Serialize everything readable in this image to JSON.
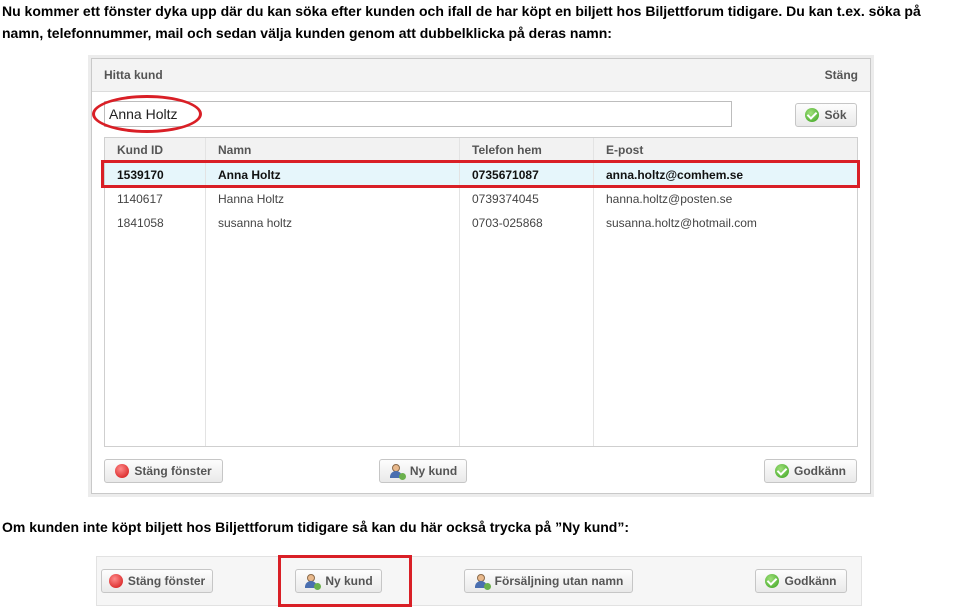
{
  "intro_text": "Nu kommer ett fönster dyka upp där du kan söka efter kunden och ifall de har köpt en biljett hos Biljettforum tidigare. Du kan t.ex. söka på namn, telefonnummer, mail och sedan välja kunden genom att dubbelklicka på deras namn:",
  "dialog": {
    "title": "Hitta kund",
    "close_label": "Stäng",
    "search_value": "Anna Holtz",
    "search_button": "Sök",
    "columns": [
      "Kund ID",
      "Namn",
      "Telefon hem",
      "E-post"
    ],
    "rows": [
      {
        "id": "1539170",
        "name": "Anna Holtz",
        "phone": "0735671087",
        "email": "anna.holtz@comhem.se"
      },
      {
        "id": "1140617",
        "name": "Hanna Holtz",
        "phone": "0739374045",
        "email": "hanna.holtz@posten.se"
      },
      {
        "id": "1841058",
        "name": "susanna holtz",
        "phone": "0703-025868",
        "email": "susanna.holtz@hotmail.com"
      }
    ],
    "close_window_button": "Stäng fönster",
    "new_customer_button": "Ny kund",
    "approve_button": "Godkänn"
  },
  "outro_text": "Om kunden inte köpt biljett hos Biljettforum tidigare så kan du här också trycka på ”Ny kund”:",
  "strip": {
    "close_window_button": "Stäng fönster",
    "new_customer_button": "Ny kund",
    "sale_without_name_button": "Försäljning utan namn",
    "approve_button": "Godkänn"
  },
  "colors": {
    "highlight": "#d91f26",
    "selected_row": "#e6f6fb"
  }
}
